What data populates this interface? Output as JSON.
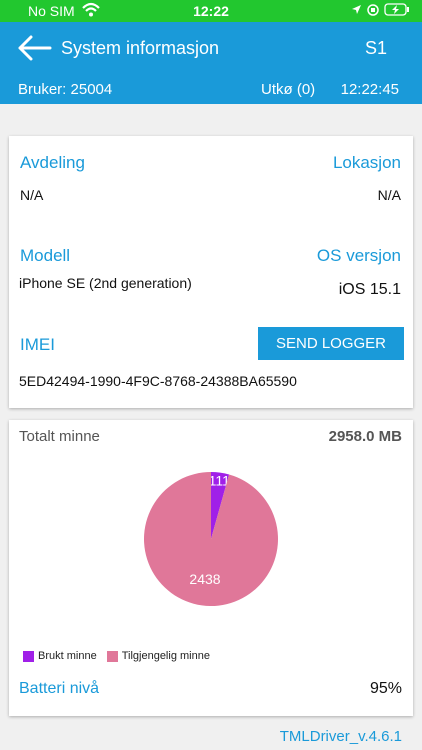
{
  "status_bar": {
    "carrier": "No SIM",
    "time": "12:22"
  },
  "header": {
    "title": "System informasjon",
    "code": "S1",
    "user": "Bruker: 25004",
    "outbox": "Utkø (0)",
    "clock": "12:22:45"
  },
  "device": {
    "department_label": "Avdeling",
    "department_value": "N/A",
    "location_label": "Lokasjon",
    "location_value": "N/A",
    "model_label": "Modell",
    "model_value": "iPhone SE (2nd generation)",
    "os_label": "OS versjon",
    "os_value": "iOS 15.1",
    "imei_label": "IMEI",
    "imei_value": "5ED42494-1990-4F9C-8768-24388BA65590",
    "send_button": "SEND LOGGER"
  },
  "memory": {
    "label": "Totalt minne",
    "total": "2958.0 MB",
    "battery_label": "Batteri nivå",
    "battery_value": "95%"
  },
  "chart_data": {
    "type": "pie",
    "slices": [
      {
        "label": "Brukt minne",
        "value": 111,
        "color": "#a020e8"
      },
      {
        "label": "Tilgjengelig minne",
        "value": 2438,
        "color": "#e07799"
      }
    ]
  },
  "footer": {
    "version": "TMLDriver_v.4.6.1"
  }
}
